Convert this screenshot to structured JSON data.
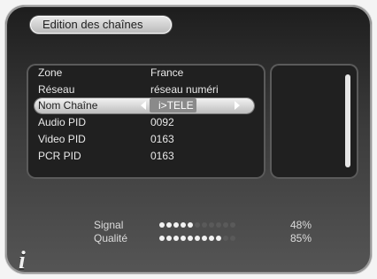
{
  "title": "Edition des chaînes",
  "fields": [
    {
      "label": "Zone",
      "value": "France"
    },
    {
      "label": "Réseau",
      "value": "réseau numéri"
    },
    {
      "label": "Nom Chaîne",
      "value": "i>TELE",
      "selected": true
    },
    {
      "label": "Audio PID",
      "value": "0092"
    },
    {
      "label": "Video PID",
      "value": "0163"
    },
    {
      "label": "PCR PID",
      "value": "0163"
    }
  ],
  "meters": [
    {
      "label": "Signal",
      "percent": "48%",
      "level": 0.48
    },
    {
      "label": "Qualité",
      "percent": "85%",
      "level": 0.85
    }
  ],
  "icons": {
    "info": "info-icon"
  }
}
